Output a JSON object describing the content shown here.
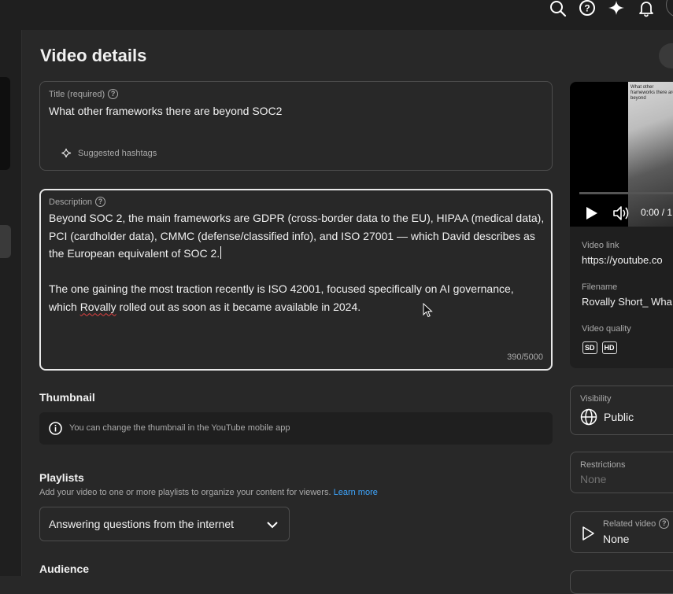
{
  "page": {
    "title": "Video details"
  },
  "top_icons": [
    "search-icon",
    "help-icon",
    "sparkle-icon",
    "bell-icon"
  ],
  "title_field": {
    "label": "Title (required)",
    "value": "What other frameworks there are beyond SOC2",
    "hashtags_label": "Suggested hashtags"
  },
  "description": {
    "label": "Description",
    "para1": "Beyond SOC 2, the main frameworks are GDPR (cross-border data to the EU), HIPAA (medical data), PCI (cardholder data), CMMC (defense/classified info), and ISO 27001 — which David describes as the European equivalent of SOC 2.",
    "para2_before": "The one gaining the most traction recently is ISO 42001, focused specifically on AI governance, which ",
    "para2_misspelled": "Rovally",
    "para2_after": " rolled out as soon as it became available in 2024.",
    "counter": "390/5000"
  },
  "thumbnail": {
    "title": "Thumbnail",
    "info": "You can change the thumbnail in the YouTube mobile app"
  },
  "playlists": {
    "title": "Playlists",
    "subtitle": "Add your video to one or more playlists to organize your content for viewers.",
    "learn_more": "Learn more",
    "selected": "Answering questions from the internet"
  },
  "audience": {
    "title": "Audience"
  },
  "video_panel": {
    "time": "0:00 / 1",
    "thumb_caption": "What other frameworks there are beyond",
    "link_label": "Video link",
    "link_value": "https://youtube.co",
    "filename_label": "Filename",
    "filename_value": "Rovally Short_ Wha",
    "quality_label": "Video quality",
    "quality_badges": [
      "SD",
      "HD"
    ]
  },
  "visibility": {
    "label": "Visibility",
    "value": "Public"
  },
  "restrictions": {
    "label": "Restrictions",
    "value": "None"
  },
  "related_video": {
    "label": "Related video",
    "value": "None"
  }
}
